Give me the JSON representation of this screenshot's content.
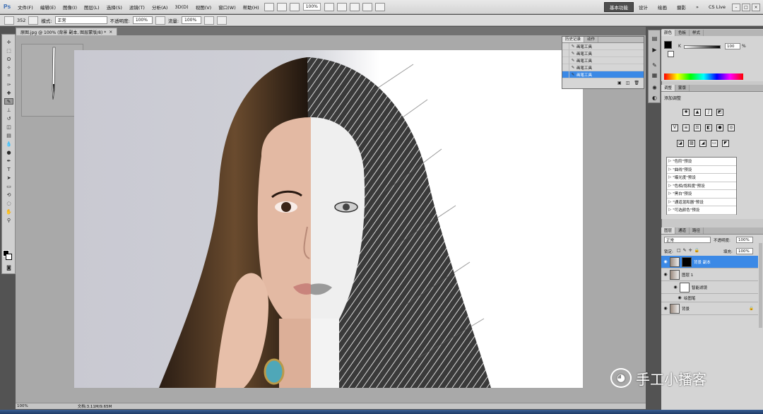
{
  "app": {
    "logo": "Ps",
    "menus": [
      "文件(F)",
      "编辑(E)",
      "图像(I)",
      "图层(L)",
      "选择(S)",
      "滤镜(T)",
      "分析(A)",
      "3D(D)",
      "视图(V)",
      "窗口(W)",
      "帮助(H)"
    ],
    "zoom": "100%",
    "workspaces": [
      "基本功能",
      "设计",
      "绘画",
      "摄影"
    ],
    "cs_live": "CS Live"
  },
  "options": {
    "brush_size": "352",
    "mode_label": "模式:",
    "mode_value": "正常",
    "opacity_label": "不透明度:",
    "opacity_value": "100%",
    "flow_label": "流量:",
    "flow_value": "100%"
  },
  "document": {
    "tab_title": "原图.jpg @ 100% (背景 副本, 图层蒙版/8) *",
    "close": "×"
  },
  "history": {
    "tabs": [
      "历史记录",
      "动作"
    ],
    "items": [
      "画笔工具",
      "画笔工具",
      "画笔工具",
      "画笔工具",
      "画笔工具"
    ],
    "selected_index": 4
  },
  "color_panel": {
    "tabs": [
      "颜色",
      "色板",
      "样式"
    ],
    "channel": "K",
    "value": "100",
    "unit": "%"
  },
  "adjustments": {
    "tabs": [
      "调整",
      "蒙版"
    ],
    "title": "添加调整",
    "presets": [
      "\"色阶\"预设",
      "\"曲线\"预设",
      "\"曝光度\"预设",
      "\"色相/饱和度\"预设",
      "\"黑白\"预设",
      "\"通道混和器\"预设",
      "\"可选颜色\"预设"
    ]
  },
  "layers": {
    "tabs": [
      "图层",
      "通道",
      "路径"
    ],
    "blend_mode": "正常",
    "opacity_label": "不透明度:",
    "opacity_value": "100%",
    "lock_label": "锁定:",
    "fill_label": "填充:",
    "fill_value": "100%",
    "rows": [
      {
        "name": "背景 副本",
        "selected": true
      },
      {
        "name": "图层 1",
        "selected": false
      },
      {
        "name": "智能滤镜",
        "selected": false
      },
      {
        "name": "绘图笔",
        "selected": false
      },
      {
        "name": "背景",
        "selected": false
      }
    ]
  },
  "status": {
    "zoom": "100%",
    "doc_size": "文档:3.11M/9.65M"
  },
  "watermark": {
    "text": "手工小播客"
  }
}
